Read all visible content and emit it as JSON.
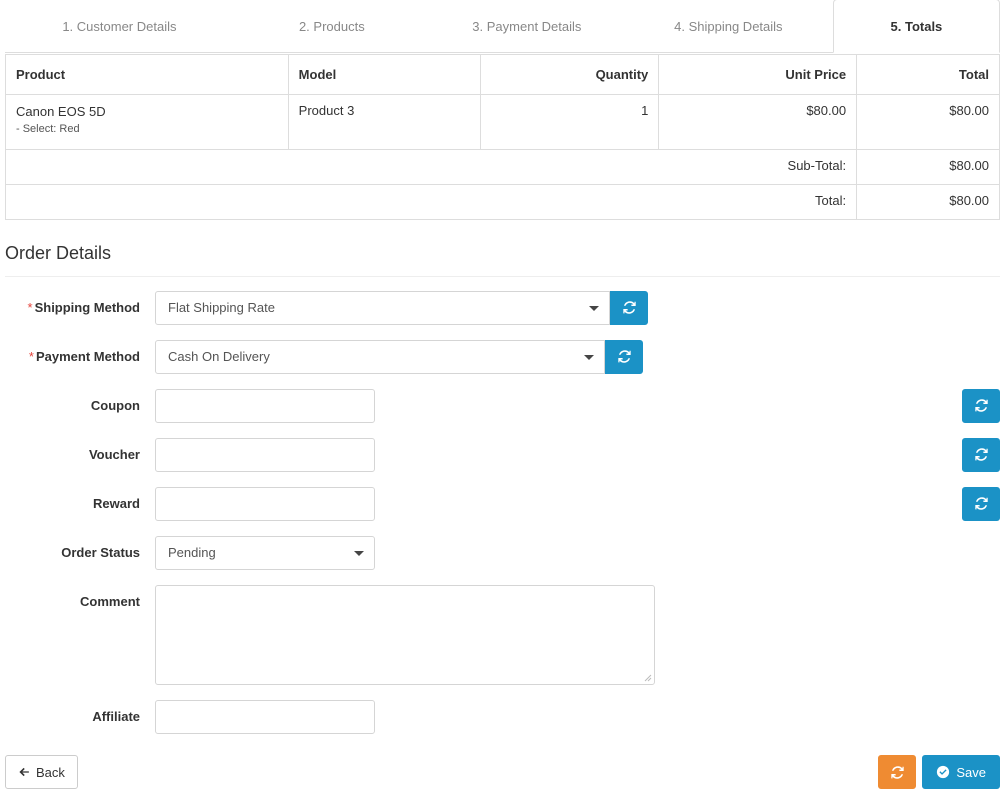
{
  "tabs": [
    {
      "label": "1. Customer Details",
      "active": false
    },
    {
      "label": "2. Products",
      "active": false
    },
    {
      "label": "3. Payment Details",
      "active": false
    },
    {
      "label": "4. Shipping Details",
      "active": false
    },
    {
      "label": "5. Totals",
      "active": true
    }
  ],
  "products_table": {
    "columns": [
      "Product",
      "Model",
      "Quantity",
      "Unit Price",
      "Total"
    ],
    "rows": [
      {
        "product": "Canon EOS 5D",
        "option": "- Select: Red",
        "model": "Product 3",
        "quantity": "1",
        "unit_price": "$80.00",
        "total": "$80.00"
      }
    ],
    "summary": [
      {
        "label": "Sub-Total:",
        "value": "$80.00"
      },
      {
        "label": "Total:",
        "value": "$80.00"
      }
    ]
  },
  "order_details": {
    "heading": "Order Details",
    "shipping_method": {
      "label": "Shipping Method",
      "required": "*",
      "value": "Flat Shipping Rate"
    },
    "payment_method": {
      "label": "Payment Method",
      "required": "*",
      "value": "Cash On Delivery"
    },
    "coupon": {
      "label": "Coupon",
      "value": "",
      "placeholder": ""
    },
    "voucher": {
      "label": "Voucher",
      "value": "",
      "placeholder": ""
    },
    "reward": {
      "label": "Reward",
      "value": "",
      "placeholder": ""
    },
    "order_status": {
      "label": "Order Status",
      "value": "Pending"
    },
    "comment": {
      "label": "Comment",
      "value": "",
      "placeholder": ""
    },
    "affiliate": {
      "label": "Affiliate",
      "value": "",
      "placeholder": ""
    }
  },
  "footer": {
    "back_label": "Back",
    "save_label": "Save"
  },
  "colors": {
    "primary_blue": "#1b92c6",
    "orange": "#ef8b32",
    "required_red": "#e4443c",
    "border": "#dddddd",
    "muted_text": "#888888"
  }
}
